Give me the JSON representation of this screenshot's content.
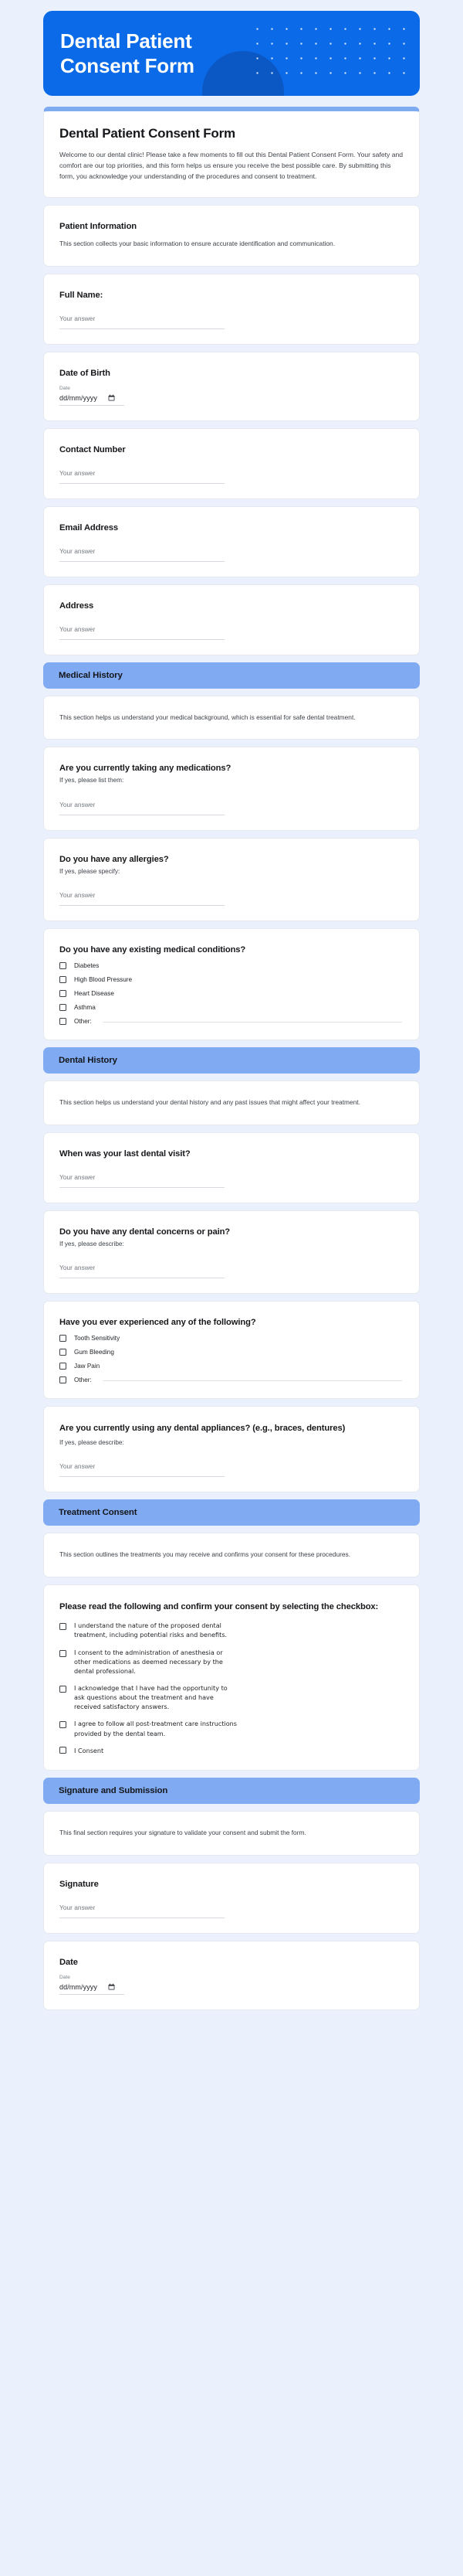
{
  "hero": {
    "title": "Dental Patient Consent Form",
    "background_color": "#0b6ae8",
    "circle_color": "#0b58c4"
  },
  "intro": {
    "title": "Dental Patient Consent Form",
    "body": "Welcome to our dental clinic! Please take a few moments to fill out this Dental Patient Consent Form. Your safety and comfort are our top priorities, and this form helps us ensure you receive the best possible care. By submitting this form, you acknowledge your understanding of the procedures and consent to treatment.",
    "accent_color": "#7eaaf0"
  },
  "section_bar_color": "#80aaf2",
  "sections": {
    "patient_information": {
      "title": "Patient Information",
      "description": "This section collects your basic information to ensure accurate identification and communication."
    },
    "medical_history": {
      "title": "Medical History",
      "description": "This section helps us understand your medical background, which is essential for safe dental treatment."
    },
    "dental_history": {
      "title": "Dental History",
      "description": "This section helps us understand your dental history and any past issues that might affect your treatment."
    },
    "treatment_consent": {
      "title": "Treatment Consent",
      "description": "This section outlines the treatments you may receive and confirms your consent for these procedures."
    },
    "signature_submission": {
      "title": "Signature and Submission",
      "description": "This final section requires your signature to validate your consent and submit the form."
    }
  },
  "fields": {
    "full_name": {
      "label": "Full Name:",
      "placeholder": "Your answer"
    },
    "date_of_birth": {
      "label": "Date of Birth",
      "date_label": "Date",
      "value": "dd/mm/yyyy"
    },
    "contact_number": {
      "label": "Contact Number",
      "placeholder": "Your answer"
    },
    "email_address": {
      "label": "Email Address",
      "placeholder": "Your answer"
    },
    "address": {
      "label": "Address",
      "placeholder": "Your answer"
    },
    "medications": {
      "label": "Are you currently taking any medications?",
      "sub": "If yes, please list them:",
      "placeholder": "Your answer"
    },
    "allergies": {
      "label": "Do you have any allergies?",
      "sub": "If yes, please specify:",
      "placeholder": "Your answer"
    },
    "medical_conditions": {
      "label": "Do you have any existing medical conditions?",
      "options": [
        "Diabetes",
        "High Blood Pressure",
        "Heart Disease",
        "Asthma",
        "Other:"
      ]
    },
    "last_visit": {
      "label": "When was your last dental visit?",
      "placeholder": "Your answer"
    },
    "dental_concerns": {
      "label": "Do you have any dental concerns or pain?",
      "sub": "If yes, please describe:",
      "placeholder": "Your answer"
    },
    "experienced": {
      "label": "Have you ever experienced any of the following?",
      "options": [
        "Tooth Sensitivity",
        "Gum Bleeding",
        "Jaw Pain",
        "Other:"
      ]
    },
    "appliances": {
      "label": "Are you currently using any dental appliances? (e.g., braces, dentures)",
      "sub": "If yes, please describe:",
      "placeholder": "Your answer"
    },
    "consent": {
      "label": "Please read the following and confirm your consent by selecting the checkbox:",
      "options": [
        "I understand the nature of the proposed dental treatment, including potential risks and benefits.",
        "I consent to the administration of anesthesia or other medications as deemed necessary by the dental professional.",
        "I acknowledge that I have had the opportunity to ask questions about the treatment and have received satisfactory answers.",
        "I agree to follow all post-treatment care instructions provided by the dental team.",
        "I Consent"
      ]
    },
    "signature": {
      "label": "Signature",
      "placeholder": "Your answer"
    },
    "date": {
      "label": "Date",
      "date_label": "Date",
      "value": "dd/mm/yyyy"
    }
  }
}
